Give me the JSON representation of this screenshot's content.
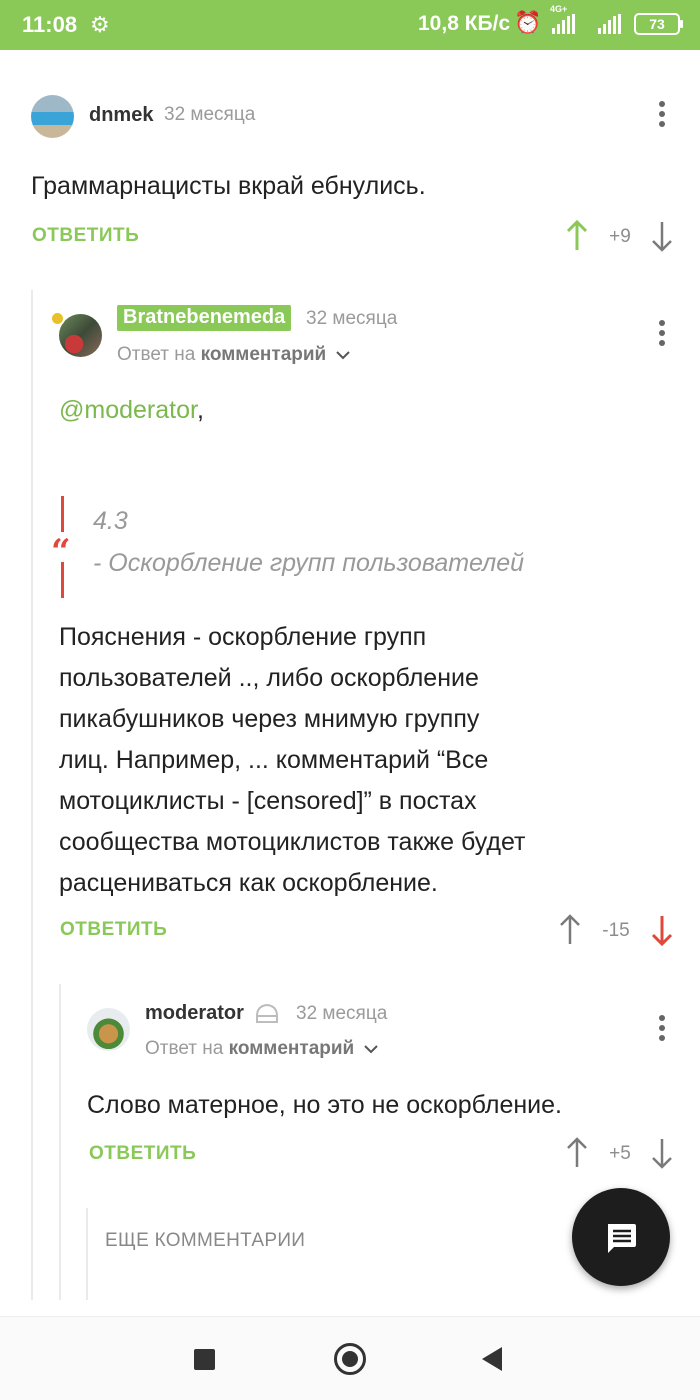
{
  "status_bar": {
    "time": "11:08",
    "net_speed": "10,8 КБ/с",
    "network_type": "4G+",
    "battery": "73"
  },
  "comments": [
    {
      "username": "dnmek",
      "time": "32 месяца",
      "text": "Граммарнацисты вкрай ебнулись.",
      "reply_label": "ОТВЕТИТЬ",
      "score": "+9"
    },
    {
      "username": "Bratnebenemeda",
      "time": "32 месяца",
      "reply_prefix": "Ответ на",
      "reply_target": "комментарий",
      "mention": "@moderator",
      "mention_suffix": ",",
      "quote_line1": "4.3",
      "quote_line2": "- Оскорбление групп пользователей",
      "paragraph": [
        "Пояснения - оскорбление групп",
        "пользователей .., либо оскорбление",
        "пикабушников через мнимую группу",
        "лиц. Например, ... комментарий “Все",
        "мотоциклисты - [censored]” в постах",
        "сообщества мотоциклистов также будет",
        "расцениваться как оскорбление."
      ],
      "reply_label": "ОТВЕТИТЬ",
      "score": "-15"
    },
    {
      "username": "moderator",
      "time": "32 месяца",
      "reply_prefix": "Ответ на",
      "reply_target": "комментарий",
      "text": "Слово матерное, но это не оскорбление.",
      "reply_label": "ОТВЕТИТЬ",
      "score": "+5"
    }
  ],
  "more_comments_label": "ЕЩЕ КОММЕНТАРИИ",
  "colors": {
    "accent_green": "#8ac858",
    "downvote_red": "#e0483c"
  },
  "icons": [
    "gear-icon",
    "alarm-icon",
    "signal-icon",
    "battery-icon",
    "kebab-menu-icon",
    "arrow-up-icon",
    "arrow-down-icon",
    "chevron-down-icon",
    "chat-icon",
    "home-circle-icon",
    "back-triangle-icon",
    "recents-square-icon"
  ]
}
